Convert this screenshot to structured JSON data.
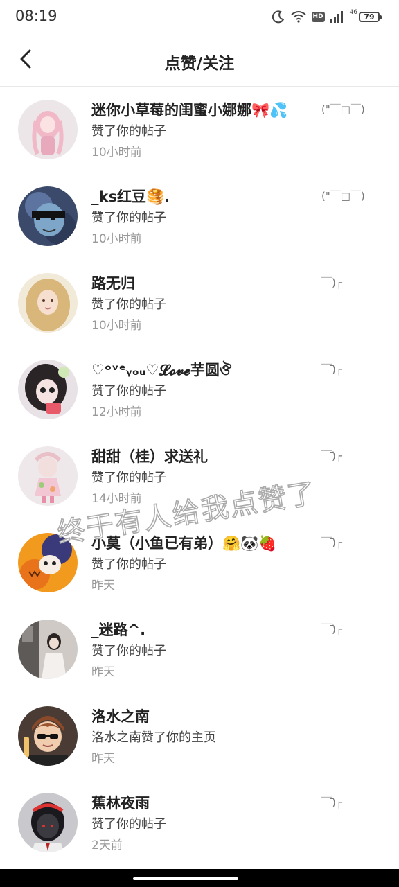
{
  "status_bar": {
    "time": "08:19",
    "network": "46",
    "hd": "HD",
    "battery": "79"
  },
  "header": {
    "title": "点赞/关注"
  },
  "notifications": [
    {
      "name": "迷你小草莓的闺蜜小娜娜🎀💦",
      "action": "赞了你的帖子",
      "time": "10小时前",
      "kaomoji": "(\"￣□￣)",
      "avatar_icon": "pink-doll-avatar"
    },
    {
      "name": "_ks红豆🥞.",
      "action": "赞了你的帖子",
      "time": "10小时前",
      "kaomoji": "(\"￣□￣)",
      "avatar_icon": "sunglasses-avatar"
    },
    {
      "name": "路无归",
      "action": "赞了你的帖子",
      "time": "10小时前",
      "kaomoji": "￣̄)┌",
      "avatar_icon": "blonde-girl-avatar"
    },
    {
      "name": "♡ᵒᵛᵉᵧₒᵤ♡𝓛𝓸𝓿𝓮芋圆ঔ",
      "action": "赞了你的帖子",
      "time": "12小时前",
      "kaomoji": "￣̄)┌",
      "avatar_icon": "doll-face-avatar"
    },
    {
      "name": "甜甜（桂）求送礼",
      "action": "赞了你的帖子",
      "time": "14小时前",
      "kaomoji": "￣̄)┌",
      "avatar_icon": "flower-doll-avatar"
    },
    {
      "name": "小莫（小鱼已有弟）🤗🐼🍓",
      "action": "赞了你的帖子",
      "time": "昨天",
      "kaomoji": "￣̄)┌",
      "avatar_icon": "halloween-avatar"
    },
    {
      "name": "_迷路^.",
      "action": "赞了你的帖子",
      "time": "昨天",
      "kaomoji": "￣̄)┌",
      "avatar_icon": "room-girl-avatar"
    },
    {
      "name": "洛水之南",
      "action": "洛水之南赞了你的主页",
      "time": "昨天",
      "kaomoji": "",
      "avatar_icon": "cartoon-boy-avatar"
    },
    {
      "name": "蕉林夜雨",
      "action": "赞了你的帖子",
      "time": "2天前",
      "kaomoji": "￣̄)┌",
      "avatar_icon": "dark-hair-avatar"
    }
  ],
  "overlay": {
    "watermark": "终于有人给我点赞了"
  }
}
